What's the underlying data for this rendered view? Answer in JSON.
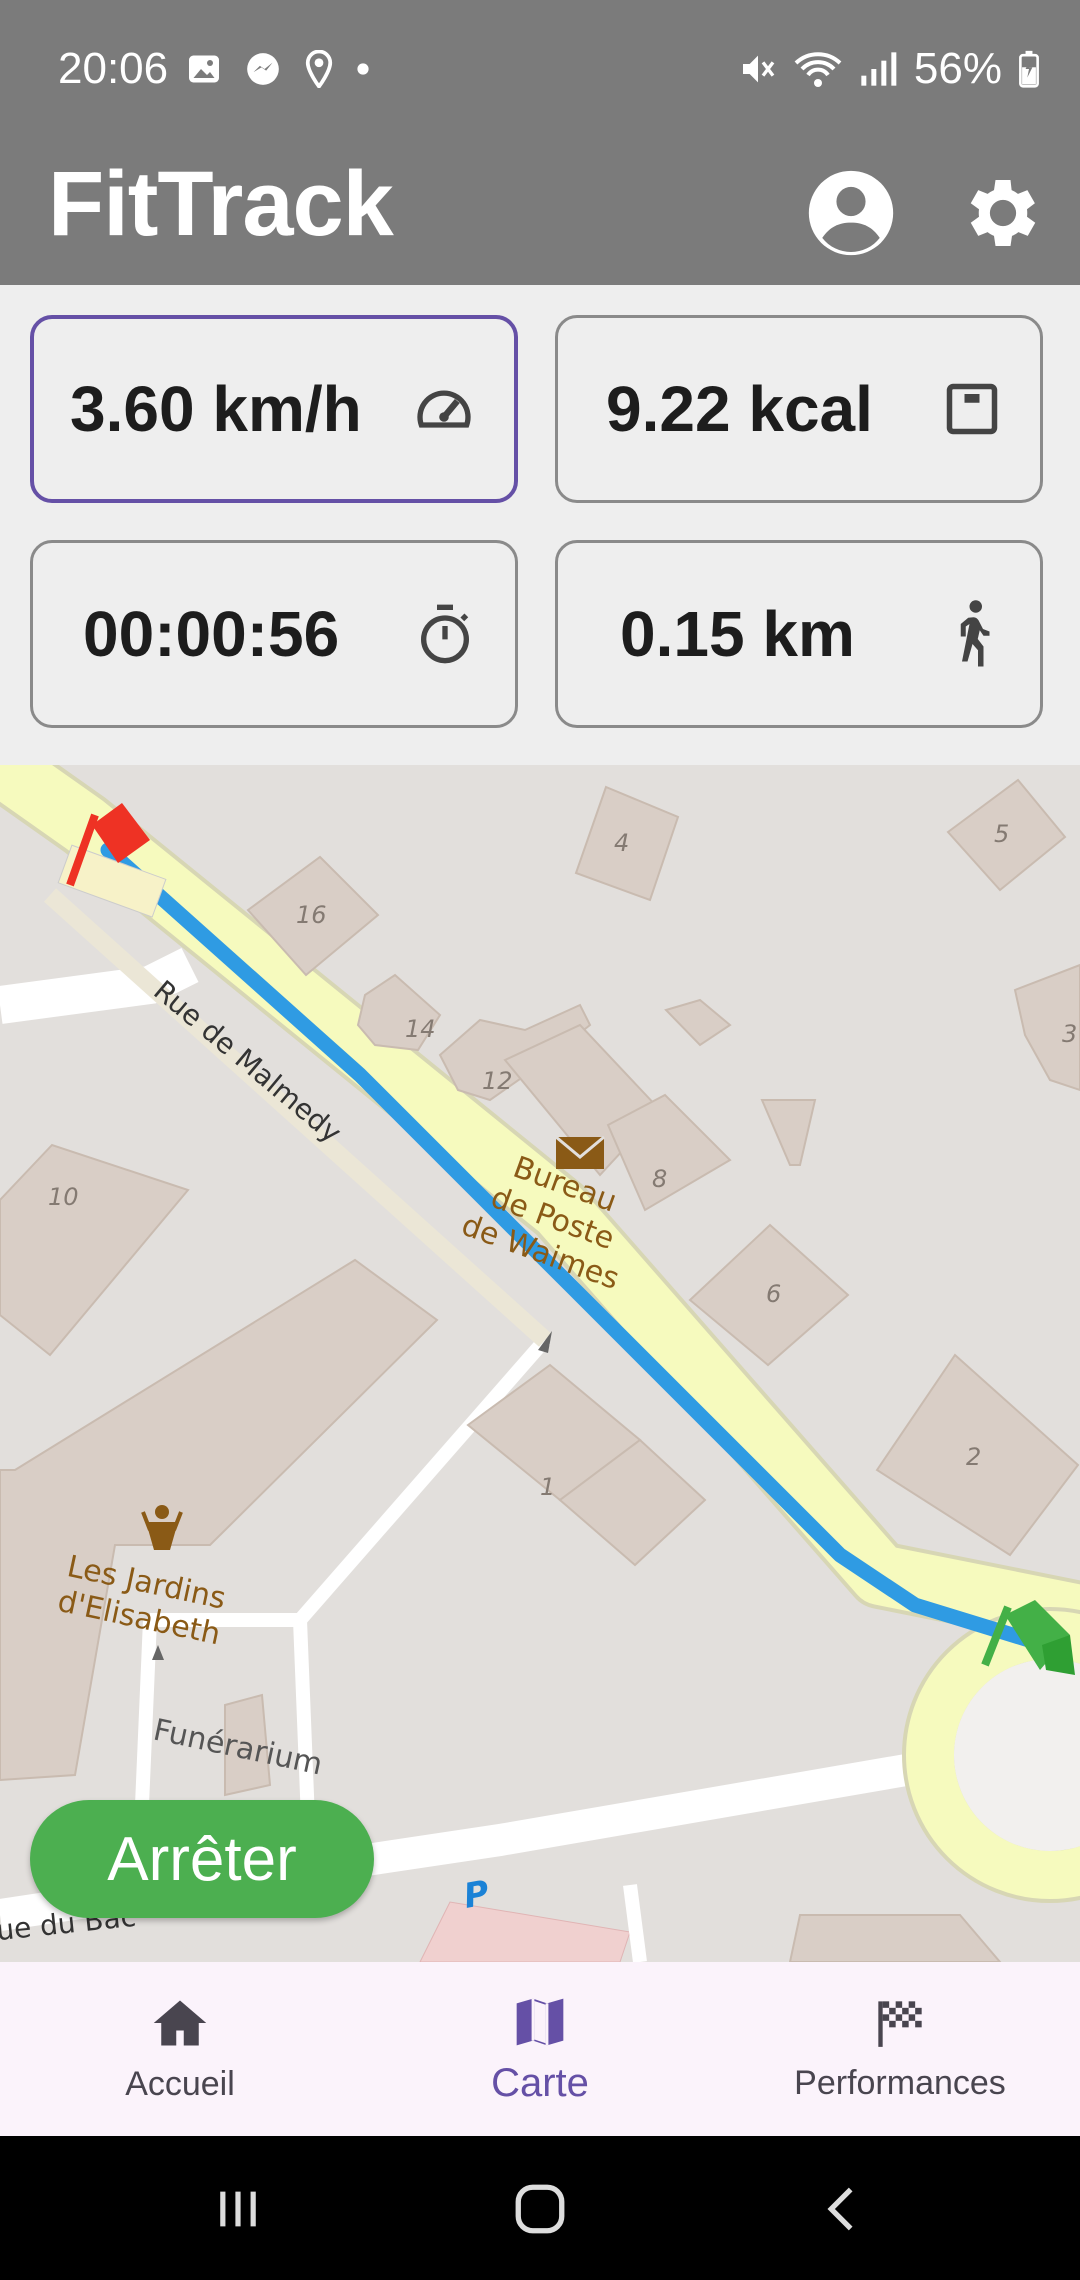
{
  "status_bar": {
    "time": "20:06",
    "battery": "56%"
  },
  "app_bar": {
    "title": "FitTrack"
  },
  "stats": {
    "speed": "3.60 km/h",
    "calories": "9.22 kcal",
    "duration": "00:00:56",
    "distance": "0.15 km"
  },
  "map": {
    "street_main": "Rue de Malmedy",
    "street_bottom": "ue du Bac",
    "poi_post": [
      "Bureau",
      "de Poste",
      "de Waimes"
    ],
    "poi_gardens": [
      "Les Jardins",
      "d'Elisabeth"
    ],
    "poi_funeral": "Funérarium",
    "parking": "P",
    "house_numbers": [
      "4",
      "5",
      "16",
      "14",
      "12",
      "8",
      "6",
      "10",
      "1",
      "2",
      "3"
    ],
    "route_color": "#2f9be3",
    "start_flag_color": "#43b047",
    "end_flag_color": "#ee3224"
  },
  "actions": {
    "stop_label": "Arrêter"
  },
  "bottom_nav": {
    "items": [
      {
        "label": "Accueil",
        "icon": "home-icon"
      },
      {
        "label": "Carte",
        "icon": "map-icon"
      },
      {
        "label": "Performances",
        "icon": "checkered-flag-icon"
      }
    ],
    "active": "Carte"
  },
  "colors": {
    "accent": "#6550a6",
    "stop_button": "#4caf50",
    "appbar": "#7b7b7b"
  }
}
